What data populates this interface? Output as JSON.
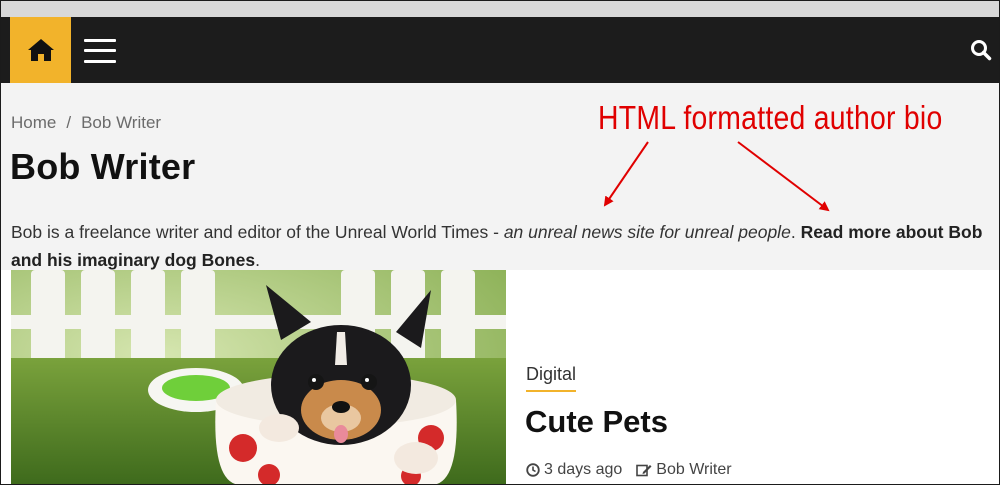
{
  "nav": {
    "home_icon": "home-icon",
    "menu_icon": "hamburger-menu-icon",
    "search_icon": "search-icon",
    "accent_color": "#f2b32b"
  },
  "breadcrumb": {
    "home": "Home",
    "separator": "/",
    "current": "Bob Writer"
  },
  "author": {
    "name": "Bob Writer",
    "bio_plain": "Bob is a freelance writer and editor of the Unreal World Times - ",
    "bio_italic": "an unreal news site for unreal people",
    "bio_period": ".",
    "bio_link": "Read more about Bob and his imaginary dog Bones",
    "bio_end": "."
  },
  "annotation": {
    "text": "HTML formatted author bio",
    "color": "#e00000"
  },
  "post": {
    "category": "Digital",
    "title": "Cute Pets",
    "date": "3 days ago",
    "author": "Bob Writer",
    "date_icon": "clock-icon",
    "author_icon": "edit-icon"
  }
}
